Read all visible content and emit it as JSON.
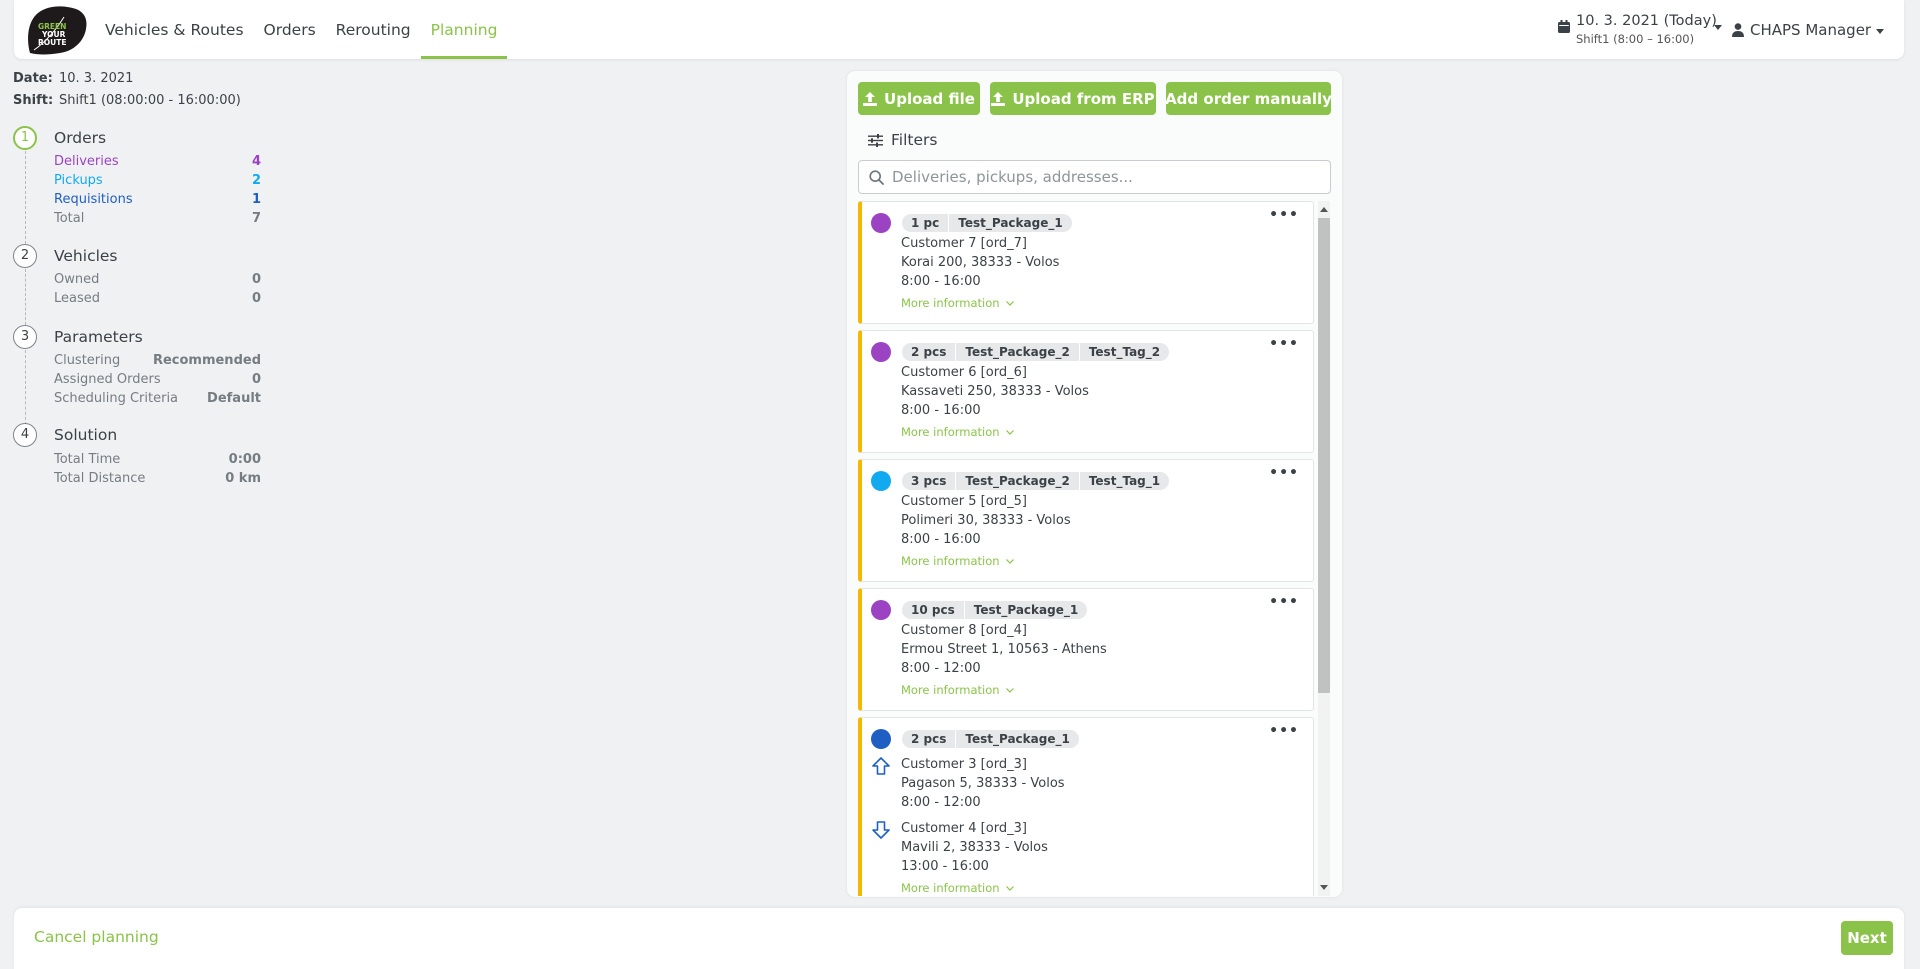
{
  "header": {
    "logo_text": [
      "GREEN",
      "YOUR",
      "ROUTE"
    ],
    "nav": [
      "Vehicles & Routes",
      "Orders",
      "Rerouting",
      "Planning"
    ],
    "date": "10. 3. 2021 (Today)",
    "shift": "Shift1 (8:00 – 16:00)",
    "user": "CHAPS Manager"
  },
  "info": {
    "date_label": "Date:",
    "date_value": "10. 3. 2021",
    "shift_label": "Shift:",
    "shift_value": "Shift1 (08:00:00 - 16:00:00)"
  },
  "steps": [
    {
      "num": "1",
      "title": "Orders",
      "rows": [
        {
          "label": "Deliveries",
          "value": "4"
        },
        {
          "label": "Pickups",
          "value": "2"
        },
        {
          "label": "Requisitions",
          "value": "1"
        },
        {
          "label": "Total",
          "value": "7"
        }
      ]
    },
    {
      "num": "2",
      "title": "Vehicles",
      "rows": [
        {
          "label": "Owned",
          "value": "0"
        },
        {
          "label": "Leased",
          "value": "0"
        }
      ]
    },
    {
      "num": "3",
      "title": "Parameters",
      "rows": [
        {
          "label": "Clustering",
          "value": "Recommended"
        },
        {
          "label": "Assigned Orders",
          "value": "0"
        },
        {
          "label": "Scheduling Criteria",
          "value": "Default"
        }
      ]
    },
    {
      "num": "4",
      "title": "Solution",
      "rows": [
        {
          "label": "Total Time",
          "value": "0:00"
        },
        {
          "label": "Total Distance",
          "value": "0 km"
        }
      ]
    }
  ],
  "toolbar": {
    "upload_file": "Upload file",
    "upload_erp": "Upload from ERP",
    "add_manual": "Add order manually",
    "filters": "Filters",
    "search_placeholder": "Deliveries, pickups, addresses..."
  },
  "orders": [
    {
      "tags": [
        "1 pc",
        "Test_Package_1"
      ],
      "customer": "Customer 7 [ord_7]",
      "address": "Korai 200, 38333 - Volos",
      "time": "8:00 - 16:00",
      "more": "More information"
    },
    {
      "tags": [
        "2 pcs",
        "Test_Package_2",
        "Test_Tag_2"
      ],
      "customer": "Customer 6 [ord_6]",
      "address": "Kassaveti 250, 38333 - Volos",
      "time": "8:00 - 16:00",
      "more": "More information"
    },
    {
      "tags": [
        "3 pcs",
        "Test_Package_2",
        "Test_Tag_1"
      ],
      "customer": "Customer 5 [ord_5]",
      "address": "Polimeri 30, 38333 - Volos",
      "time": "8:00 - 16:00",
      "more": "More information"
    },
    {
      "tags": [
        "10 pcs",
        "Test_Package_1"
      ],
      "customer": "Customer 8 [ord_4]",
      "address": "Ermou Street 1, 10563 - Athens",
      "time": "8:00 - 12:00",
      "more": "More information"
    },
    {
      "tags": [
        "2 pcs",
        "Test_Package_1"
      ],
      "pickup": {
        "customer": "Customer 3 [ord_3]",
        "address": "Pagason 5, 38333 - Volos",
        "time": "8:00 - 12:00"
      },
      "delivery": {
        "customer": "Customer 4 [ord_3]",
        "address": "Mavili 2, 38333 - Volos",
        "time": "13:00 - 16:00"
      },
      "more": "More information"
    }
  ],
  "footer": {
    "cancel": "Cancel planning",
    "next": "Next"
  },
  "colors": {
    "accent": "#8bc34a",
    "delivery": "#9c43c4",
    "pickup": "#11aaf0",
    "requisition": "#1f5fc3",
    "card_border": "#f5b800"
  }
}
